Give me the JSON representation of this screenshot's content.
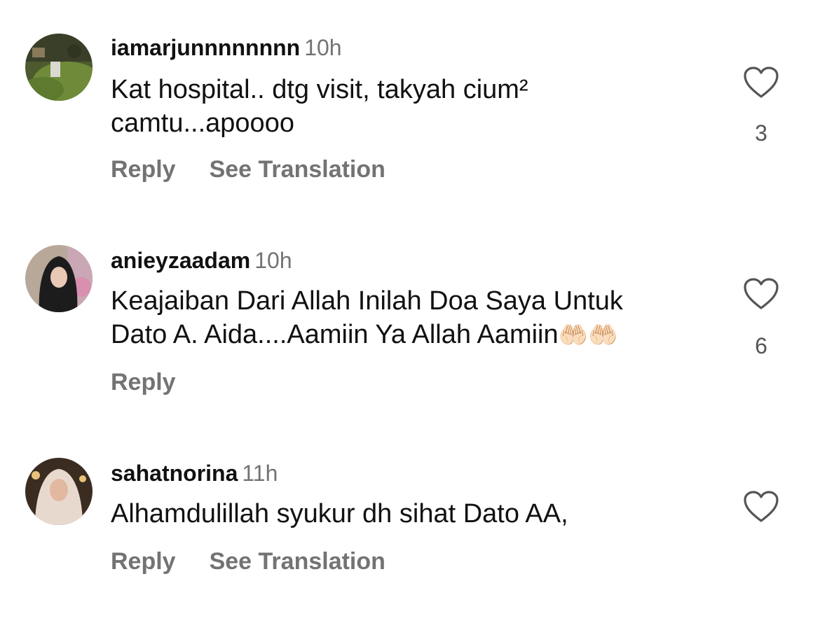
{
  "comments": [
    {
      "username": "iamarjunnnnnnnn",
      "time": "10h",
      "text_line1": "Kat hospital.. dtg visit, takyah cium²",
      "text_line2": "camtu...apoooo",
      "reply_label": "Reply",
      "translate_label": "See Translation",
      "likes": "3",
      "avatar_icon": "avatar-photo-outdoor"
    },
    {
      "username": "anieyzaadam",
      "time": "10h",
      "text_line1": "Keajaiban Dari Allah Inilah Doa Saya Untuk",
      "text_line2": "Dato A. Aida....Aamiin Ya Allah Aamiin",
      "emoji": "🤲🏻🤲🏻",
      "reply_label": "Reply",
      "likes": "6",
      "avatar_icon": "avatar-photo-hijab-woman"
    },
    {
      "username": "sahatnorina",
      "time": "11h",
      "text_line1": "Alhamdulillah syukur dh sihat Dato AA,",
      "reply_label": "Reply",
      "translate_label": "See Translation",
      "avatar_icon": "avatar-photo-hijab-woman-light"
    }
  ],
  "colors": {
    "text": "#111111",
    "muted": "#737373",
    "background": "#ffffff"
  },
  "icons": {
    "like": "heart-outline-icon"
  }
}
